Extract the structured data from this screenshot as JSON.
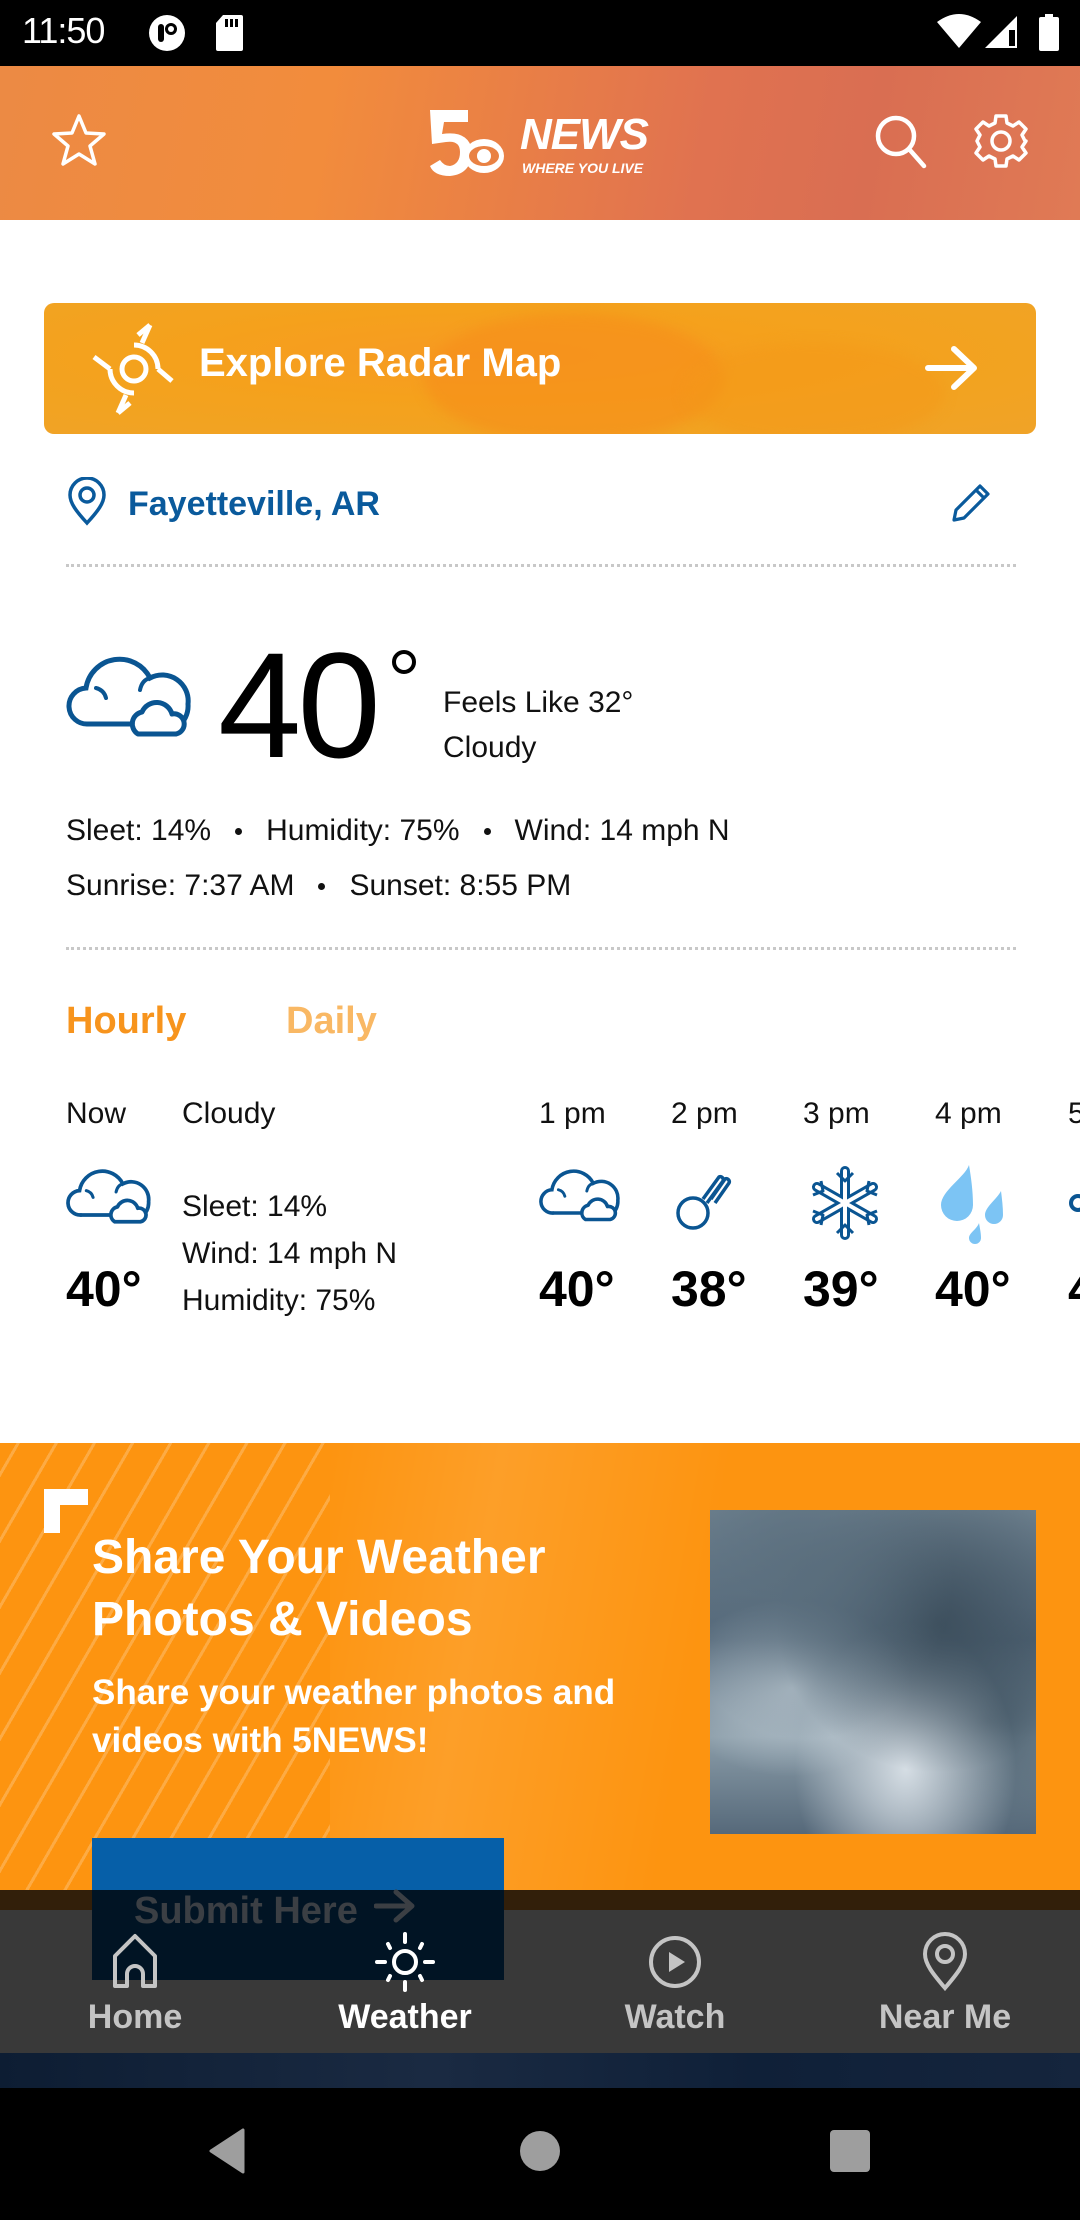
{
  "status_bar": {
    "time": "11:50",
    "left_icons": [
      "notification-app-icon",
      "sd-card-icon"
    ],
    "right_icons": [
      "wifi-icon",
      "cell-signal-icon",
      "battery-icon"
    ]
  },
  "header": {
    "logo_main": "NEWS",
    "logo_number": "5",
    "logo_tagline": "WHERE YOU LIVE",
    "left_button_icon": "star-icon",
    "right_button_icons": [
      "search-icon",
      "gear-icon"
    ]
  },
  "radar_banner": {
    "label": "Explore Radar Map",
    "icon": "radar-icon",
    "arrow_icon": "arrow-right-icon"
  },
  "location": {
    "city": "Fayetteville, AR",
    "icon": "map-pin-icon",
    "edit_icon": "pencil-icon"
  },
  "current": {
    "temperature": "40",
    "feels_like": "Feels Like 32°",
    "condition": "Cloudy",
    "icon": "cloudy-icon",
    "stats_line1": [
      "Sleet: 14%",
      "Humidity: 75%",
      "Wind: 14 mph N"
    ],
    "stats_line2": [
      "Sunrise: 7:37 AM",
      "Sunset: 8:55 PM"
    ]
  },
  "forecast_tabs": [
    {
      "label": "Hourly",
      "active": true
    },
    {
      "label": "Daily",
      "active": false
    }
  ],
  "hourly": {
    "now": {
      "label": "Now",
      "condition": "Cloudy",
      "temp": "40°",
      "icon": "cloudy-icon",
      "details": [
        "Sleet: 14%",
        "Wind: 14 mph N",
        "Humidity: 75%"
      ]
    },
    "hours": [
      {
        "time": "1 pm",
        "temp": "40°",
        "icon": "cloudy-icon"
      },
      {
        "time": "2 pm",
        "temp": "38°",
        "icon": "sleet-icon"
      },
      {
        "time": "3 pm",
        "temp": "39°",
        "icon": "snowflake-icon"
      },
      {
        "time": "4 pm",
        "temp": "40°",
        "icon": "rain-drops-icon"
      },
      {
        "time": "5",
        "temp": "4",
        "icon": "snowflake-icon"
      }
    ]
  },
  "promo": {
    "title": "Share Your Weather Photos & Videos",
    "subtitle": "Share your weather photos and videos with 5NEWS!",
    "button_label": "Submit Here",
    "image_alt": "storm clouds photo"
  },
  "bottom_nav": [
    {
      "label": "Home",
      "icon": "home-icon",
      "active": false
    },
    {
      "label": "Weather",
      "icon": "sun-icon",
      "active": true
    },
    {
      "label": "Watch",
      "icon": "play-circle-icon",
      "active": false
    },
    {
      "label": "Near Me",
      "icon": "map-pin-icon",
      "active": false
    }
  ],
  "system_nav": [
    "back-icon",
    "home-circle-icon",
    "recents-icon"
  ],
  "colors": {
    "accent_orange": "#f7941d",
    "accent_orange_light": "#f9b864",
    "brand_blue": "#0a5a9c",
    "icon_blue": "#0a5592",
    "rain_blue": "#7cc4f4",
    "nav_bg": "#393939"
  }
}
